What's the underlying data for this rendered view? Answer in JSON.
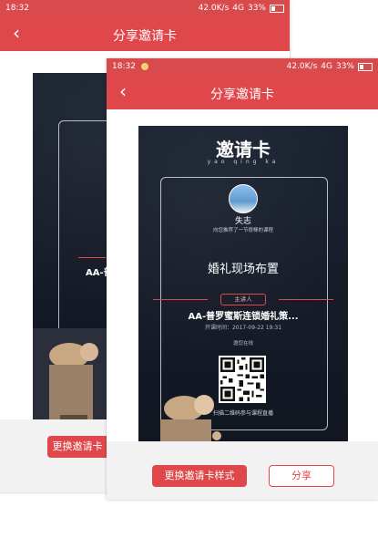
{
  "status_bar": {
    "time": "18:32",
    "network_speed": "42.0K/s",
    "signal": "4G",
    "battery": "33%"
  },
  "nav": {
    "title": "分享邀请卡",
    "back_icon": "chevron-left-icon"
  },
  "card": {
    "heading": "邀请卡",
    "pinyin": "yao qing ka",
    "user_name": "失志",
    "recommend_text": "向您推荐了一节很棒的课程",
    "course_title": "婚礼现场布置",
    "lecturer_label": "主讲人",
    "lecturer_name": "AA-普罗蜜斯连锁婚礼策...",
    "start_time": "开课时间：2017-09-22  19:31",
    "invite_note": "邀您在线",
    "scan_text": "扫描二维码参与课程直播"
  },
  "back_screen_partial": {
    "lecturer_name": "AA-普",
    "change_button": "更换邀请卡"
  },
  "actions": {
    "change_style": "更换邀请卡样式",
    "share": "分享"
  },
  "colors": {
    "accent": "#e0474a",
    "card_bg": "#1a2230"
  }
}
